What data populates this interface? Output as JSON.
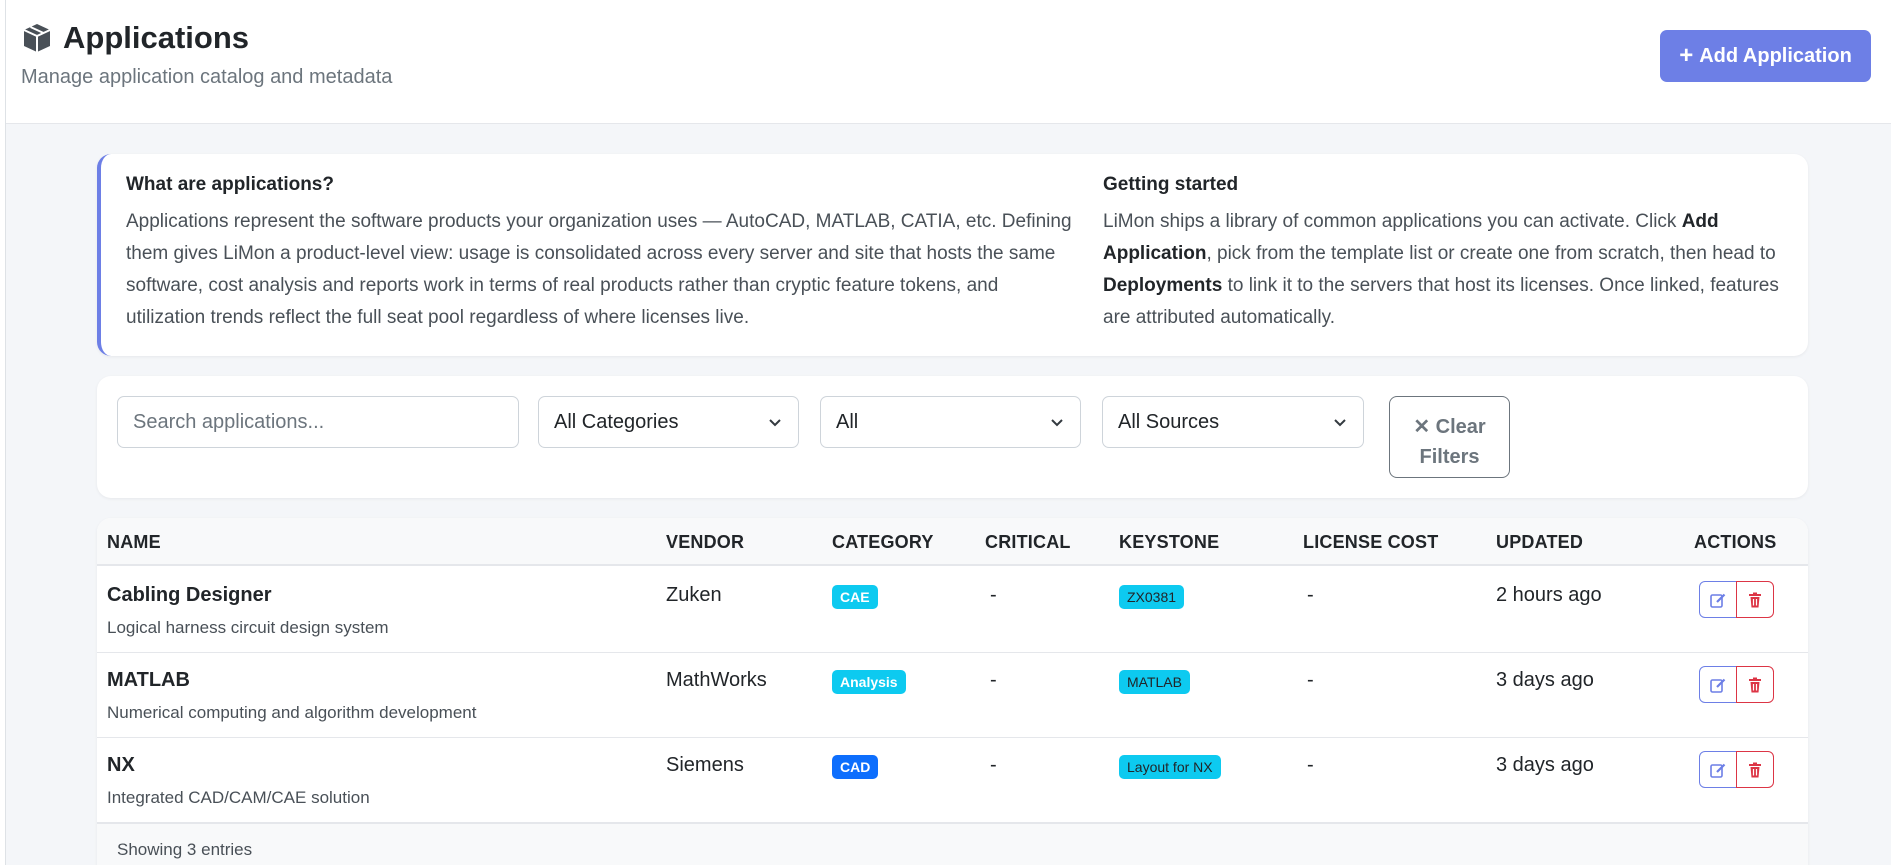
{
  "header": {
    "icon": "box-icon",
    "title": "Applications",
    "subtitle": "Manage application catalog and metadata",
    "add_button": "Add Application",
    "accent_color": "#6d7fe6"
  },
  "info": {
    "left_heading": "What are applications?",
    "left_body": "Applications represent the software products your organization uses — AutoCAD, MATLAB, CATIA, etc. Defining them gives LiMon a product-level view: usage is consolidated across every server and site that hosts the same software, cost analysis and reports work in terms of real products rather than cryptic feature tokens, and utilization trends reflect the full seat pool regardless of where licenses live.",
    "right_heading": "Getting started",
    "right_body_1": "LiMon ships a library of common applications you can activate. Click ",
    "right_bold_1": "Add Application",
    "right_body_2": ", pick from the template list or create one from scratch, then head to ",
    "right_bold_2": "Deployments",
    "right_body_3": " to link it to the servers that host its licenses. Once linked, features are attributed automatically."
  },
  "filters": {
    "search_placeholder": "Search applications...",
    "category": "All Categories",
    "critical": "All",
    "source": "All Sources",
    "clear_line1": "✕ Clear",
    "clear_line2": "Filters"
  },
  "table": {
    "columns": [
      "NAME",
      "VENDOR",
      "CATEGORY",
      "CRITICAL",
      "KEYSTONE",
      "LICENSE COST",
      "UPDATED",
      "ACTIONS"
    ],
    "rows": [
      {
        "name": "Cabling Designer",
        "description": "Logical harness circuit design system",
        "vendor": "Zuken",
        "category": "CAE",
        "critical": "-",
        "keystone": "ZX0381",
        "cost": "-",
        "updated": "2 hours ago"
      },
      {
        "name": "MATLAB",
        "description": "Numerical computing and algorithm development",
        "vendor": "MathWorks",
        "category": "Analysis",
        "critical": "-",
        "keystone": "MATLAB",
        "cost": "-",
        "updated": "3 days ago"
      },
      {
        "name": "NX",
        "description": "Integrated CAD/CAM/CAE solution",
        "vendor": "Siemens",
        "category": "CAD",
        "critical": "-",
        "keystone": "Layout for NX",
        "cost": "-",
        "updated": "3 days ago"
      }
    ],
    "footer": "Showing 3 entries"
  }
}
